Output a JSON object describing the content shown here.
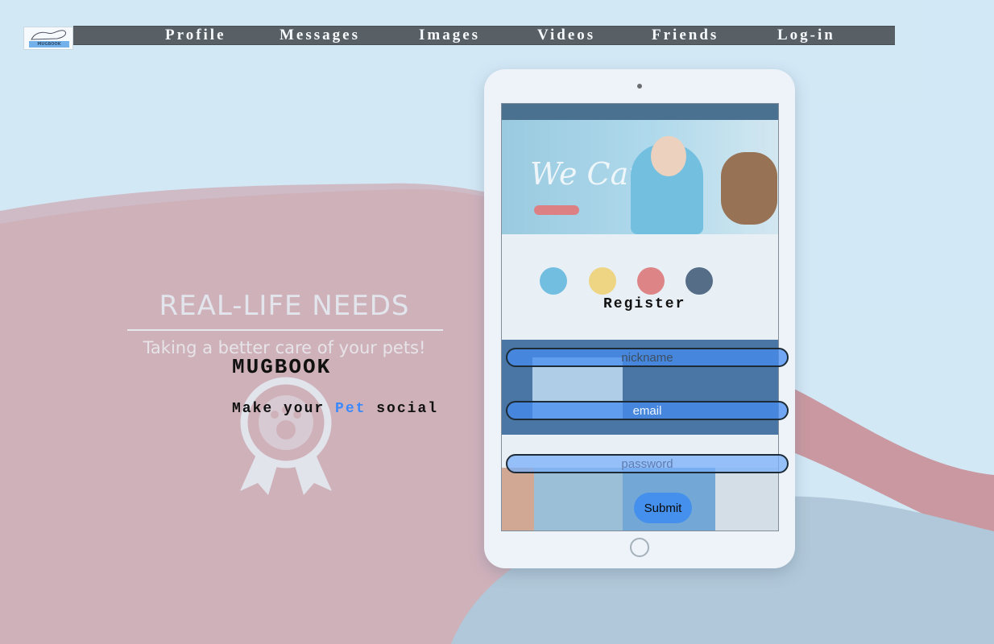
{
  "logo": {
    "label": "MUGBOOK"
  },
  "nav": {
    "items": [
      "Profile",
      "Messages",
      "Images",
      "Videos",
      "Friends",
      "Log-in"
    ]
  },
  "promo": {
    "heading": "REAL-LIFE NEEDS",
    "subheading": "Taking a better care of your pets!"
  },
  "brand": {
    "name": "MUGBOOK",
    "tagline_before": "Make your ",
    "tagline_highlight": "Pet",
    "tagline_after": " social"
  },
  "tablet_screen": {
    "hero_text": "We Care"
  },
  "register": {
    "title": "Register",
    "nickname_placeholder": "nickname",
    "email_placeholder": "email",
    "password_placeholder": "password",
    "submit_label": "Submit"
  },
  "colors": {
    "navbar": "#3e4447",
    "pet_accent": "#3a89ff",
    "background_sky": "#d3e9f6",
    "background_wave": "#cfa6ae",
    "background_floor": "#a9c2d3"
  },
  "icons": {
    "award_badge": "paw-award-badge-icon",
    "logo": "mugbook-logo"
  }
}
